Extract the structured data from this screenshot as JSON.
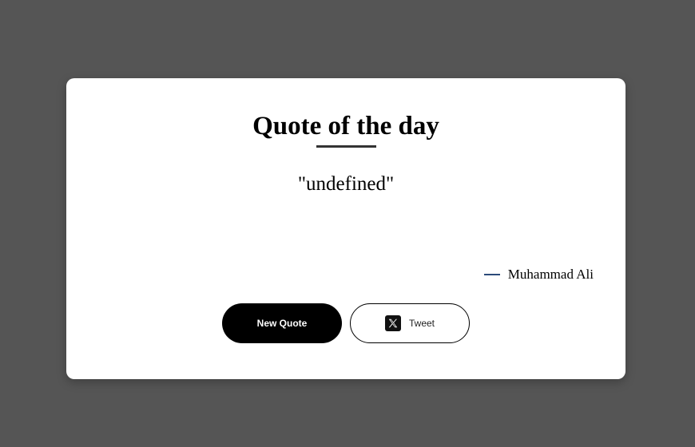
{
  "card": {
    "title": "Quote of the day",
    "quote": "\"undefined\"",
    "author": "Muhammad Ali"
  },
  "buttons": {
    "new_quote_label": "New Quote",
    "tweet_label": "Tweet"
  },
  "icons": {
    "tweet_icon": "x-logo-icon"
  },
  "colors": {
    "background": "#555555",
    "card": "#ffffff",
    "primary_button": "#000000",
    "author_dash": "#2b4a7a"
  }
}
